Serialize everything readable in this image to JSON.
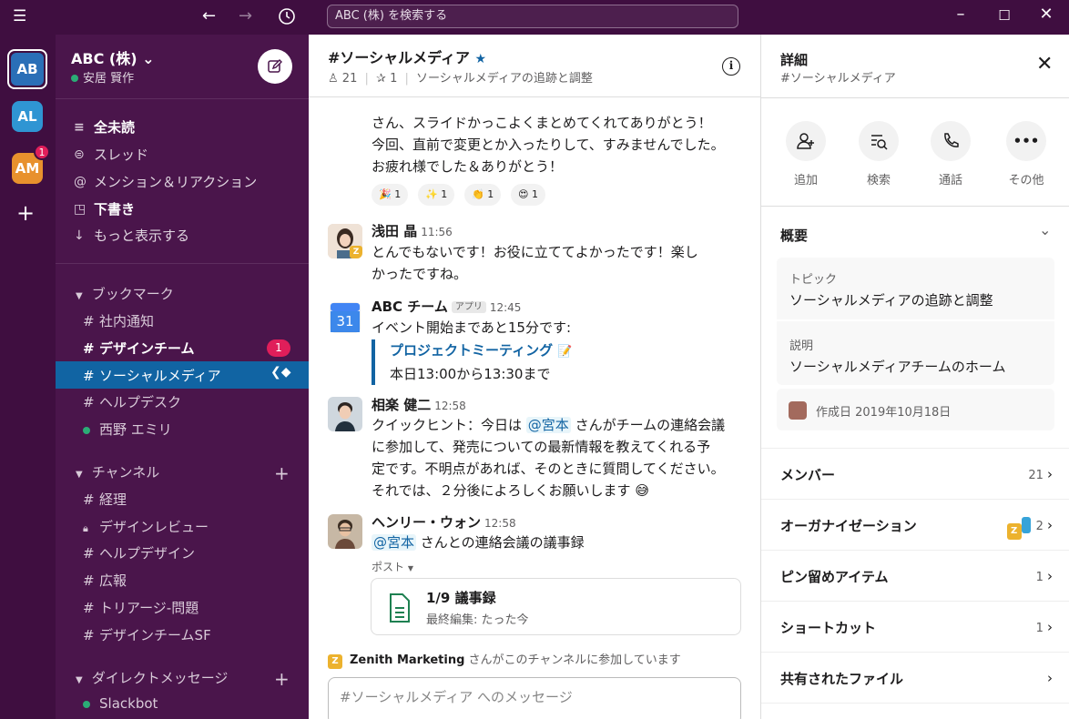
{
  "topbar": {
    "search_placeholder": "ABC (株) を検索する"
  },
  "workspaces": {
    "current": "AB",
    "second": "AL",
    "third": "AM",
    "third_badge": "1"
  },
  "sidebar": {
    "workspace_name": "ABC (株) ⌄",
    "user_name": "安居 賢作",
    "nav": [
      "全未読",
      "スレッド",
      "メンション＆リアクション",
      "下書き",
      "もっと表示する"
    ],
    "bookmarks_header": "ブックマーク",
    "bookmarks": [
      "社内通知",
      "デザインチーム",
      "ソーシャルメディア",
      "ヘルプデスク",
      "西野 エミリ"
    ],
    "design_team_badge": "1",
    "channels_header": "チャンネル",
    "channels": [
      "経理",
      "デザインレビュー",
      "ヘルプデザイン",
      "広報",
      "トリアージ-問題",
      "デザインチームSF"
    ],
    "dm_header": "ダイレクトメッセージ",
    "dms": [
      "Slackbot"
    ]
  },
  "channel": {
    "title": "#ソーシャルメディア",
    "members": "21",
    "pins": "1",
    "topic": "ソーシャルメディアの追跡と調整"
  },
  "messages": {
    "m0_lines": [
      "さん、スライドかっこよくまとめてくれてありがとう！",
      "今回、直前で変更とか入ったりして、すみませんでした。",
      "お疲れ様でした＆ありがとう！"
    ],
    "reactions": [
      "🎉 1",
      "✨ 1",
      "👏 1",
      "😍 1"
    ],
    "m1_author": "浅田 晶",
    "m1_time": "11:56",
    "m1_lines": [
      "とんでもないです！お役に立ててよかったです！楽し",
      "かったですね。"
    ],
    "m2_author": "ABC チーム",
    "m2_tag": "アプリ",
    "m2_time": "12:45",
    "m2_text": "イベント開始まであと15分です:",
    "m2_quote_title": "プロジェクトミーティング",
    "m2_quote_text": "本日13:00から13:30まで",
    "m3_author": "相楽 健二",
    "m3_time": "12:58",
    "m3_l1_a": "クイックヒント：今日は ",
    "m3_mention": "@宮本",
    "m3_l1_b": " さんがチームの連絡会議",
    "m3_lines": [
      "に参加して、発売についての最新情報を教えてくれる予",
      "定です。不明点があれば、そのときに質問してください。",
      "それでは、２分後によろしくお願いします 😅"
    ],
    "m4_author": "ヘンリー・ウォン",
    "m4_time": "12:58",
    "m4_mention": "@宮本",
    "m4_text": " さんとの連絡会議の議事録",
    "m4_post_label": "ポスト",
    "post_title": "1/9 議事録",
    "post_sub": "最終編集: たった今",
    "join_org": "Zenith Marketing",
    "join_text": " さんがこのチャンネルに参加しています",
    "calendar_day": "31"
  },
  "composer": {
    "placeholder": "#ソーシャルメディア へのメッセージ"
  },
  "details": {
    "title": "詳細",
    "subtitle": "#ソーシャルメディア",
    "actions": [
      "追加",
      "検索",
      "通話",
      "その他"
    ],
    "overview": "概要",
    "topic_label": "トピック",
    "topic_value": "ソーシャルメディアの追跡と調整",
    "desc_label": "説明",
    "desc_value": "ソーシャルメディアチームのホーム",
    "created": "作成日 2019年10月18日",
    "rows": [
      {
        "label": "メンバー",
        "count": "21"
      },
      {
        "label": "オーガナイゼーション",
        "count": "2"
      },
      {
        "label": "ピン留めアイテム",
        "count": "1"
      },
      {
        "label": "ショートカット",
        "count": "1"
      },
      {
        "label": "共有されたファイル",
        "count": ""
      }
    ]
  },
  "colors": {
    "aubergine": "#3f0e40",
    "sidebar": "#4a154b",
    "active": "#1164a3",
    "badge": "#e01e5a",
    "link": "#1264a3"
  }
}
